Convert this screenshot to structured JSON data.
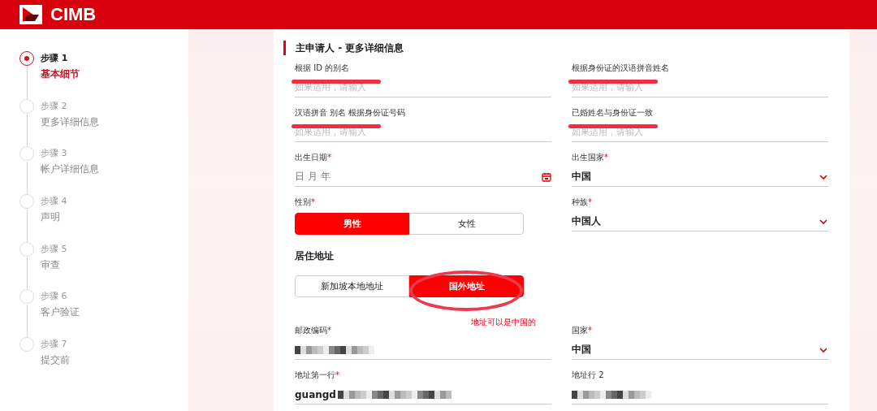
{
  "header": {
    "logo": "CIMB"
  },
  "steps": [
    {
      "step": "步骤 1",
      "title": "基本细节",
      "selected": true
    },
    {
      "step": "步骤 2",
      "title": "更多详细信息",
      "selected": false
    },
    {
      "step": "步骤 3",
      "title": "帐户详细信息",
      "selected": false
    },
    {
      "step": "步骤 4",
      "title": "声明",
      "selected": false
    },
    {
      "step": "步骤 5",
      "title": "审查",
      "selected": false
    },
    {
      "step": "步骤 6",
      "title": "客户验证",
      "selected": false
    },
    {
      "step": "步骤 7",
      "title": "提交前",
      "selected": false
    }
  ],
  "card": {
    "title": "主申请人 - 更多详细信息",
    "fields": [
      {
        "kind": "text",
        "label": "根据 ID 的别名",
        "placeholder": "如果适用，请输入",
        "struck": true
      },
      {
        "kind": "text",
        "label": "根据身份证的汉语拼音姓名",
        "placeholder": "如果适用，请输入",
        "struck": true
      },
      {
        "kind": "text",
        "label": "汉语拼音 别名 根据身份证号码",
        "placeholder": "如果适用，请输入",
        "struck": true
      },
      {
        "kind": "text",
        "label": "已婚姓名与身份证一致",
        "placeholder": "如果适用，请输入",
        "struck": true
      },
      {
        "kind": "date",
        "label": "出生日期",
        "mark": "*",
        "placeholder": "日 月 年"
      },
      {
        "kind": "select",
        "label": "出生国家",
        "mark": "*",
        "value": "中国"
      },
      {
        "kind": "toggle",
        "label": "性别",
        "mark": "*",
        "options": [
          {
            "label": "男性",
            "selected": true
          },
          {
            "label": "女性",
            "selected": false
          }
        ]
      },
      {
        "kind": "select",
        "label": "种族",
        "mark": "*",
        "value": "中国人"
      },
      {
        "kind": "section",
        "title": "居住地址",
        "options": [
          {
            "label": "新加坡本地地址",
            "selected": false,
            "circled": false
          },
          {
            "label": "国外地址",
            "selected": true,
            "circled": true
          }
        ],
        "note": "地址可以是中国的"
      },
      {
        "kind": "redacted",
        "label": "邮政编码",
        "mark": "*"
      },
      {
        "kind": "select",
        "label": "国家",
        "mark": "*",
        "value": "中国"
      },
      {
        "kind": "redacted",
        "label": "地址第一行",
        "mark": "*",
        "value": "guangd"
      },
      {
        "kind": "redacted",
        "label": "地址行 2"
      }
    ]
  }
}
